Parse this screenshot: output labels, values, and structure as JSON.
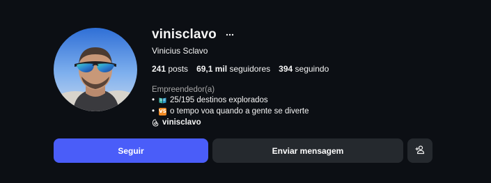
{
  "profile": {
    "username": "vinisclavo",
    "full_name": "Vinicius Sclavo",
    "stats": {
      "posts_count": "241",
      "posts_label": "posts",
      "followers_count": "69,1 mil",
      "followers_label": "seguidores",
      "following_count": "394",
      "following_label": "seguindo"
    },
    "category": "Empreendedor(a)",
    "bio": {
      "line1_text": "25/195 destinos explorados",
      "line1_emoji": "open-book-emoji",
      "line2_text": "o tempo voa quando a gente se diverte",
      "line2_emoji": "vs-emoji",
      "line2_emoji_text": "VS"
    },
    "threads_handle": "vinisclavo"
  },
  "buttons": {
    "follow_label": "Seguir",
    "message_label": "Enviar mensagem"
  },
  "icons": {
    "more": "more-options-icon",
    "threads": "threads-icon",
    "suggest": "add-person-icon"
  },
  "colors": {
    "background": "#0c0f14",
    "follow_button": "#4a5df9",
    "secondary_button": "#25292e",
    "muted_text": "#a8a8a8",
    "primary_text": "#f5f5f5"
  }
}
